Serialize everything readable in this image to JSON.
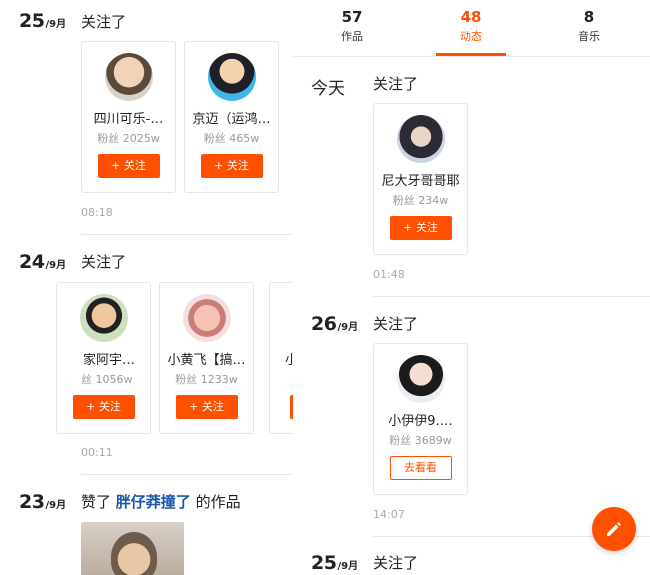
{
  "tabs": [
    {
      "count": "57",
      "label": "作品"
    },
    {
      "count": "48",
      "label": "动态"
    },
    {
      "count": "8",
      "label": "音乐"
    }
  ],
  "accent_color": "#ff5000",
  "left_feed": {
    "day25": {
      "day": "25",
      "month": "/9月",
      "action": "关注了",
      "time": "08:18",
      "cards": [
        {
          "name": "四川可乐-…",
          "fans": "粉丝 2025w",
          "button": "+ 关注"
        },
        {
          "name": "京迈（运鸿…",
          "fans": "粉丝 465w",
          "button": "+ 关注"
        }
      ]
    },
    "day24": {
      "day": "24",
      "month": "/9月",
      "action": "关注了",
      "time": "00:11",
      "cards": [
        {
          "name": "家阿宇…",
          "fans": "丝 1056w",
          "button": "+ 关注"
        },
        {
          "name": "小黄飞【搞…",
          "fans": "粉丝 1233w",
          "button": "+ 关注"
        },
        {
          "name": "小",
          "fans": "",
          "button": ""
        }
      ]
    },
    "day23": {
      "day": "23",
      "month": "/9月",
      "action_prefix": "赞了",
      "action_link": "胖仔莽撞了",
      "action_suffix": "的作品"
    }
  },
  "right_feed": {
    "today": {
      "label": "今天",
      "action": "关注了",
      "time": "01:48",
      "card": {
        "name": "尼大牙哥哥耶",
        "fans": "粉丝 234w",
        "button": "+ 关注"
      }
    },
    "day26": {
      "day": "26",
      "month": "/9月",
      "action": "关注了",
      "time": "14:07",
      "card": {
        "name": "小伊伊9.…",
        "fans": "粉丝 3689w",
        "button": "去看看"
      }
    },
    "day25": {
      "day": "25",
      "month": "/9月",
      "action": "关注了"
    }
  },
  "icons": {
    "fab": "edit-pencil-icon",
    "avatar_badge": "小黄飞"
  }
}
